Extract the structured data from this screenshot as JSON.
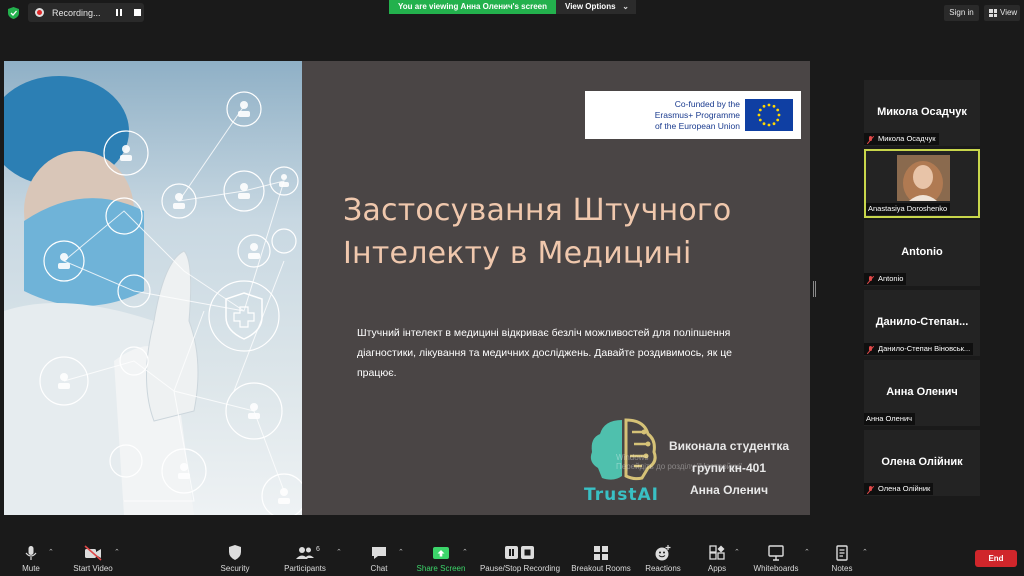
{
  "topbar": {
    "recording_label": "Recording...",
    "viewing_banner": "You are viewing Анна Оленич's screen",
    "view_options_label": "View Options",
    "sign_in_label": "Sign in",
    "view_label": "View"
  },
  "slide": {
    "eu_text": [
      "Co-funded by the",
      "Erasmus+ Programme",
      "of the European Union"
    ],
    "title_line1": "Застосування Штучного",
    "title_line2": "Інтелекту в Медицині",
    "body": "Штучний інтелект в медицині відкриває безліч можливостей для поліпшення діагностики, лікування та медичних досліджень. Давайте роздивимось, як це працює.",
    "logo_text": "TrustAI",
    "author_line1": "Виконала студентка",
    "author_line2": "групи кн-401",
    "author_line3": "Анна Оленич",
    "watermark_line1": "Windows",
    "watermark_line2": "Перейдіть до розділу \"Настройки\""
  },
  "participants": [
    {
      "display_name": "Микола Осадчук",
      "name_tag": "Микола Осадчук",
      "muted": true
    },
    {
      "display_name": "",
      "name_tag": "Anastasiya Doroshenko",
      "muted": false,
      "video": true,
      "active_speaker": true
    },
    {
      "display_name": "Antonio",
      "name_tag": "Antonio",
      "muted": true
    },
    {
      "display_name": "Данило-Степан...",
      "name_tag": "Данило-Степан Віновськ...",
      "muted": true
    },
    {
      "display_name": "Анна Оленич",
      "name_tag": "Анна Оленич",
      "muted": false
    },
    {
      "display_name": "Олена Олійник",
      "name_tag": "Олена Олійник",
      "muted": true
    }
  ],
  "toolbar": {
    "mute": "Mute",
    "start_video": "Start Video",
    "security": "Security",
    "participants": "Participants",
    "participants_count": "6",
    "chat": "Chat",
    "share_screen": "Share Screen",
    "pause_stop_recording": "Pause/Stop Recording",
    "breakout_rooms": "Breakout Rooms",
    "reactions": "Reactions",
    "apps": "Apps",
    "whiteboards": "Whiteboards",
    "notes": "Notes",
    "end": "End"
  },
  "colors": {
    "share_green": "#3cd56a",
    "viewing_banner": "#23b14d",
    "end_red": "#d0262b",
    "active_border": "#c8d64b",
    "slide_bg": "#4a4545",
    "title_color": "#f0c8ad",
    "logo_teal": "#39c0c4"
  }
}
